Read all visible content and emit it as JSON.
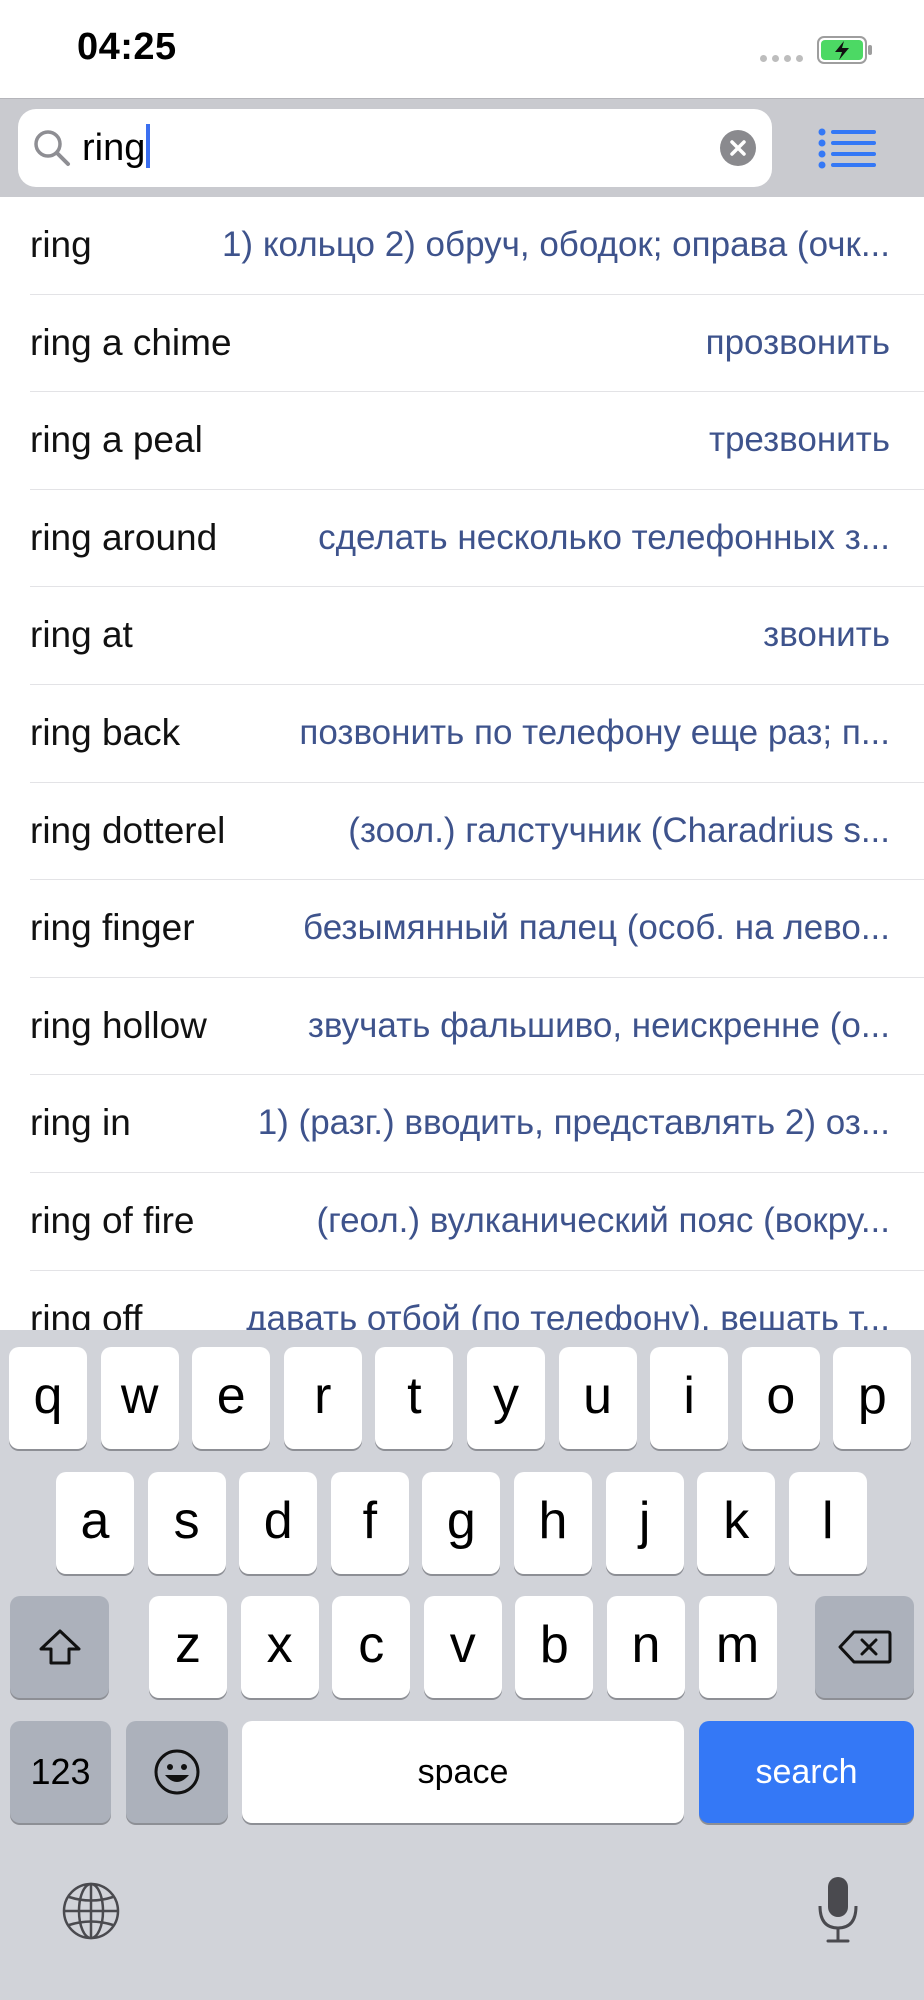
{
  "status_bar": {
    "time": "04:25"
  },
  "search": {
    "query": "ring"
  },
  "results": [
    {
      "word": "ring",
      "translation": "1) кольцо  2) обруч, ободок; оправа (очк..."
    },
    {
      "word": "ring a chime",
      "translation": "прозвонить"
    },
    {
      "word": "ring a peal",
      "translation": "трезвонить"
    },
    {
      "word": "ring around",
      "translation": "сделать несколько телефонных з..."
    },
    {
      "word": "ring at",
      "translation": "звонить"
    },
    {
      "word": "ring back",
      "translation": "позвонить по телефону еще раз; п..."
    },
    {
      "word": "ring dotterel",
      "translation": "(зоол.) галстучник (Charadrius s..."
    },
    {
      "word": "ring finger",
      "translation": "безымянный палец (особ. на лево..."
    },
    {
      "word": "ring hollow",
      "translation": "звучать фальшиво, неискренне (о..."
    },
    {
      "word": "ring in",
      "translation": "1) (разг.) вводить, представлять  2) оз..."
    },
    {
      "word": "ring of fire",
      "translation": "(геол.) вулканический пояс (вокру..."
    },
    {
      "word": "ring off",
      "translation": "давать отбой (по телефону), вешать т..."
    }
  ],
  "keyboard": {
    "row1": [
      "q",
      "w",
      "e",
      "r",
      "t",
      "y",
      "u",
      "i",
      "o",
      "p"
    ],
    "row2": [
      "a",
      "s",
      "d",
      "f",
      "g",
      "h",
      "j",
      "k",
      "l"
    ],
    "row3": [
      "z",
      "x",
      "c",
      "v",
      "b",
      "n",
      "m"
    ],
    "numbers_label": "123",
    "space_label": "space",
    "search_label": "search"
  },
  "colors": {
    "accent": "#3478f6",
    "translation_text": "#3e538c",
    "keyboard_bg": "#d1d3d9"
  },
  "icons": [
    "search-icon",
    "clear-icon",
    "list-icon",
    "battery-icon",
    "shift-icon",
    "backspace-icon",
    "emoji-icon",
    "globe-icon",
    "microphone-icon"
  ]
}
